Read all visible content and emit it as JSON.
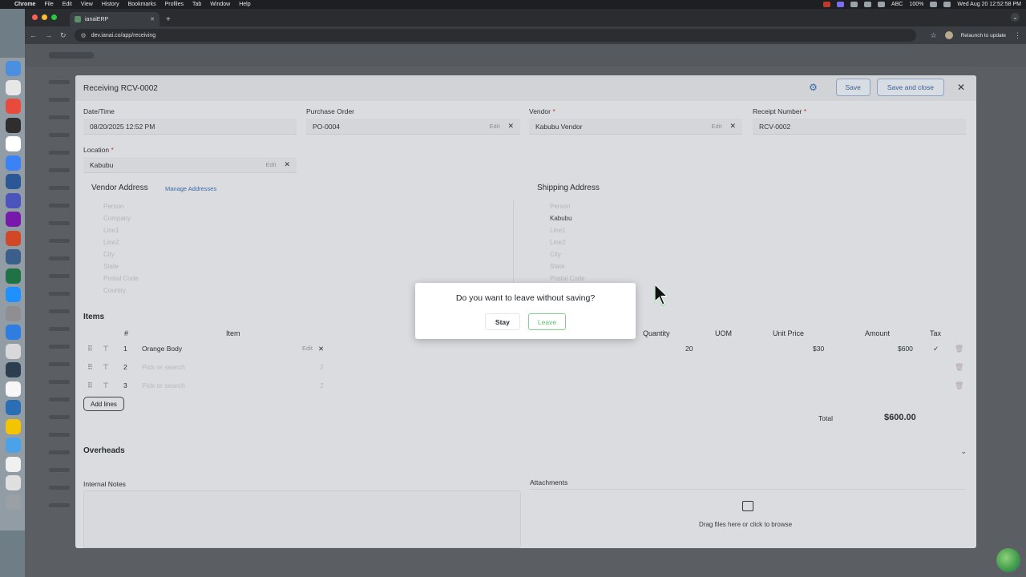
{
  "menubar": {
    "app": "Chrome",
    "items": [
      "File",
      "Edit",
      "View",
      "History",
      "Bookmarks",
      "Profiles",
      "Tab",
      "Window",
      "Help"
    ],
    "battery": "100%",
    "input": "ABC",
    "clock": "Wed Aug 20  12:52:58 PM"
  },
  "browser": {
    "tab_title": "ianaiERP",
    "url": "dev.ianai.co/app/receiving",
    "relaunch": "Relaunch to update"
  },
  "modal": {
    "title": "Receiving RCV-0002",
    "save": "Save",
    "save_close": "Save and close",
    "fields": {
      "datetime_label": "Date/Time",
      "datetime_value": "08/20/2025 12:52 PM",
      "po_label": "Purchase Order",
      "po_value": "PO-0004",
      "vendor_label": "Vendor",
      "vendor_value": "Kabubu Vendor",
      "receipt_label": "Receipt Number",
      "receipt_value": "RCV-0002",
      "location_label": "Location",
      "location_value": "Kabubu",
      "edit": "Edit",
      "required": "*"
    },
    "vendor_address": {
      "title": "Vendor Address",
      "manage": "Manage Addresses",
      "lines": [
        "Person",
        "Company",
        "Line1",
        "Line2",
        "City",
        "State",
        "Postal Code",
        "Country"
      ]
    },
    "shipping_address": {
      "title": "Shipping Address",
      "lines": [
        "Person",
        "Kabubu",
        "Line1",
        "Line2",
        "City",
        "State",
        "Postal Code"
      ]
    },
    "items": {
      "title": "Items",
      "headers": {
        "num": "#",
        "item": "Item",
        "quantity": "Quantity",
        "uom": "UOM",
        "unit_price": "Unit Price",
        "amount": "Amount",
        "tax": "Tax"
      },
      "rows": [
        {
          "num": "1",
          "item": "Orange Body",
          "edit": "Edit",
          "quantity": "20",
          "unit_price": "$30",
          "amount": "$600",
          "tax": "✓"
        },
        {
          "num": "2",
          "item": "Pick or search",
          "x": "2"
        },
        {
          "num": "3",
          "item": "Pick or search",
          "x": "2"
        }
      ],
      "add_lines": "Add lines",
      "total_label": "Total",
      "total_value": "$600.00"
    },
    "overheads": "Overheads",
    "internal_notes": "Internal Notes",
    "attachments": "Attachments",
    "drop_text": "Drag files here or click to browse"
  },
  "dialog": {
    "question": "Do you want to leave without saving?",
    "stay": "Stay",
    "leave": "Leave"
  }
}
